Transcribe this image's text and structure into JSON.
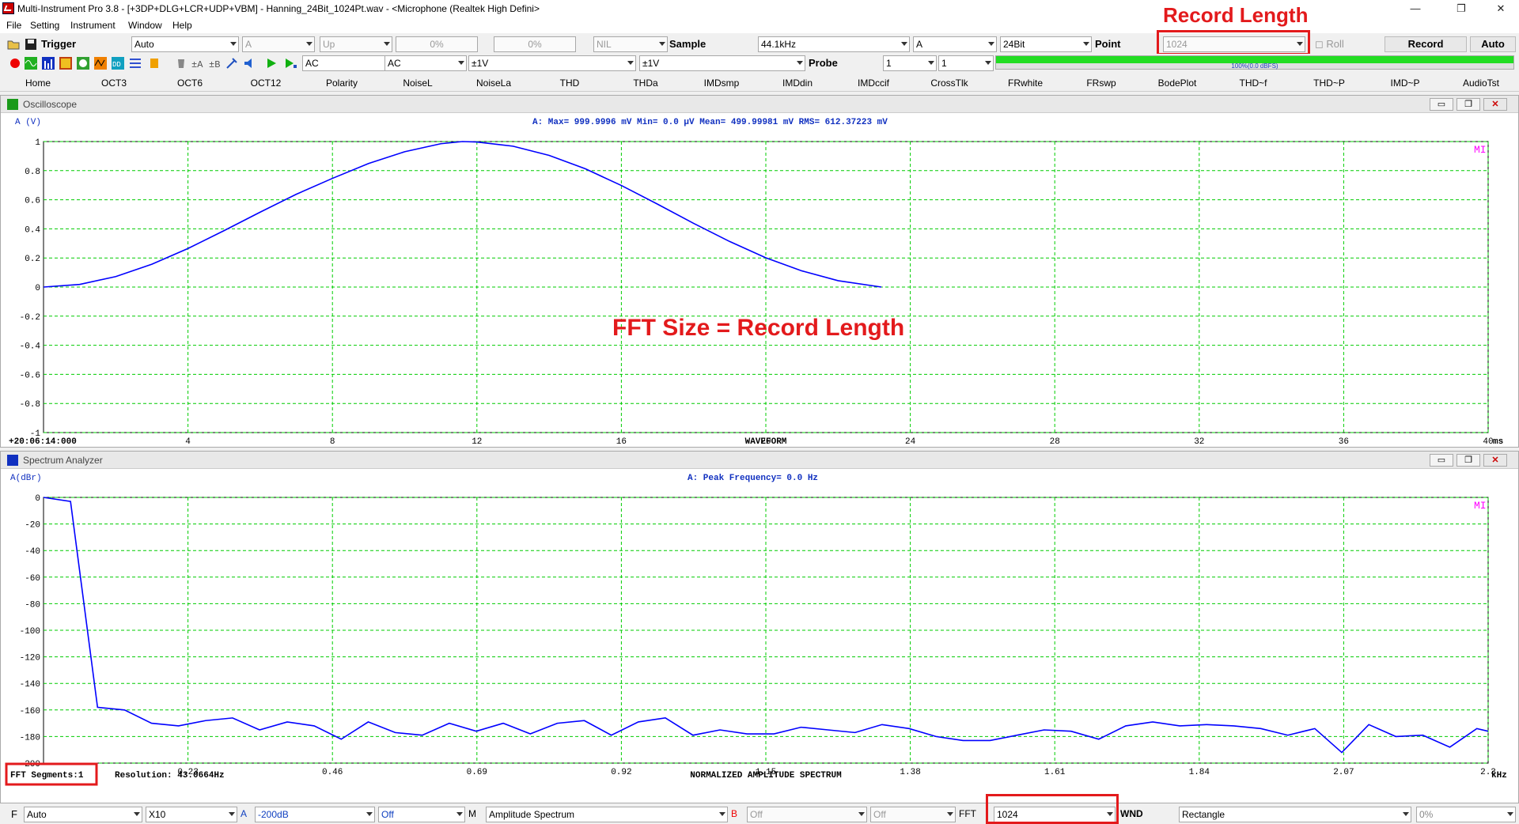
{
  "window": {
    "title": "Multi-Instrument Pro 3.8  -  [+3DP+DLG+LCR+UDP+VBM]  -  Hanning_24Bit_1024Pt.wav  -  <Microphone (Realtek High Defini>",
    "minimize": "—",
    "maximize": "❐",
    "close": "✕"
  },
  "menu": [
    "File",
    "Setting",
    "Instrument",
    "Window",
    "Help"
  ],
  "toolbar1": {
    "trigger_label": "Trigger",
    "trigger_mode": "Auto",
    "trigger_channel": "A",
    "trigger_edge": "Up",
    "trigger_level": "0%",
    "trigger_delay": "0%",
    "trigger_nil": "NIL",
    "sample_label": "Sample",
    "sample_rate": "44.1kHz",
    "sample_channel": "A",
    "bit_depth": "24Bit",
    "point_label": "Point",
    "record_length": "1024",
    "roll_label": "Roll",
    "record_button": "Record",
    "auto_button": "Auto"
  },
  "toolbar2": {
    "coupling_a": "AC",
    "coupling_b": "AC",
    "range_a": "±1V",
    "range_b": "±1V",
    "probe_label": "Probe",
    "probe_a": "1",
    "probe_b": "1",
    "progress_text": "100%(0.0 dBFS)",
    "progress_fraction": 1.0
  },
  "tabs": [
    "Home",
    "OCT3",
    "OCT6",
    "OCT12",
    "Polarity",
    "NoiseL",
    "NoiseLa",
    "THD",
    "THDa",
    "IMDsmp",
    "IMDdin",
    "IMDccif",
    "CrossTlk",
    "FRwhite",
    "FRswp",
    "BodePlot",
    "THD~f",
    "THD~P",
    "IMD~P",
    "AudioTst"
  ],
  "annotations": {
    "record_length": "Record Length",
    "fft_size": "FFT Size = Record Length"
  },
  "oscilloscope": {
    "title": "Oscilloscope",
    "unit_label": "A (V)",
    "stats": "A: Max=   999.9996 mV  Min=      0.0 µV  Mean=   499.99981 mV  RMS=   612.37223 mV",
    "timestamp": "+20:06:14:000",
    "xlabel": "WAVEFORM",
    "xunit": "ms",
    "mi_badge": "MI"
  },
  "spectrum": {
    "title": "Spectrum Analyzer",
    "unit_label": "A(dBr)",
    "peak": "A: Peak Frequency=    0.0  Hz",
    "xlabel": "NORMALIZED AMPLITUDE SPECTRUM",
    "xunit": "kHz",
    "segments": "FFT Segments:1",
    "resolution": "Resolution: 43.0664Hz",
    "mi_badge": "MI"
  },
  "bottombar": {
    "f_label": "F",
    "f_mode": "Auto",
    "zoom": "X10",
    "a_label": "A",
    "a_range": "-200dB",
    "a_off": "Off",
    "m_label": "M",
    "m_mode": "Amplitude Spectrum",
    "b_label": "B",
    "b_off1": "Off",
    "b_off2": "Off",
    "fft_label": "FFT",
    "fft_size": "1024",
    "wnd_label": "WND",
    "window_fn": "Rectangle",
    "overlap": "0%"
  },
  "colors": {
    "trace": "#0000ff",
    "grid": "#00cc00",
    "annotation": "#e31a1c",
    "mi_badge": "#ff00ff"
  },
  "chart_data": [
    {
      "type": "line",
      "name": "oscilloscope",
      "xlabel": "WAVEFORM",
      "xunit": "ms",
      "ylabel": "A (V)",
      "xlim": [
        0,
        40
      ],
      "ylim": [
        -1,
        1
      ],
      "xticks": [
        4,
        8,
        12,
        16,
        20,
        24,
        28,
        32,
        36,
        40
      ],
      "yticks": [
        1,
        0.8,
        0.6,
        0.4,
        0.2,
        0,
        -0.2,
        -0.4,
        -0.6,
        -0.8,
        -1
      ],
      "ytick_labels": [
        "1",
        "0.8",
        "0.6",
        "0.4",
        "0.2",
        "0",
        "-0.2",
        "-0.4",
        "-0.6",
        "-0.8",
        "-1"
      ],
      "grid": true,
      "series": [
        {
          "x": [
            0,
            1,
            2,
            3,
            4,
            5,
            6,
            7,
            8,
            9,
            10,
            11,
            11.6,
            12,
            13,
            14,
            15,
            16,
            17,
            18,
            19,
            20,
            21,
            22,
            23.2
          ],
          "y": [
            0,
            0.018,
            0.072,
            0.157,
            0.265,
            0.388,
            0.515,
            0.638,
            0.747,
            0.849,
            0.93,
            0.985,
            1.0,
            0.997,
            0.968,
            0.905,
            0.813,
            0.698,
            0.57,
            0.438,
            0.313,
            0.201,
            0.111,
            0.044,
            0
          ]
        }
      ]
    },
    {
      "type": "line",
      "name": "spectrum",
      "xlabel": "NORMALIZED AMPLITUDE SPECTRUM",
      "xunit": "kHz",
      "ylabel": "A(dBr)",
      "xlim": [
        0,
        2.3
      ],
      "ylim": [
        -200,
        0
      ],
      "xticks": [
        0.23,
        0.46,
        0.69,
        0.92,
        1.15,
        1.38,
        1.61,
        1.84,
        2.07,
        2.3
      ],
      "yticks": [
        0,
        -20,
        -40,
        -60,
        -80,
        -100,
        -120,
        -140,
        -160,
        -180,
        -200
      ],
      "grid": true,
      "series": [
        {
          "x": [
            0.0,
            0.043,
            0.086,
            0.129,
            0.172,
            0.215,
            0.258,
            0.301,
            0.344,
            0.388,
            0.431,
            0.474,
            0.517,
            0.56,
            0.603,
            0.646,
            0.689,
            0.732,
            0.775,
            0.818,
            0.861,
            0.904,
            0.947,
            0.99,
            1.034,
            1.077,
            1.12,
            1.163,
            1.206,
            1.249,
            1.292,
            1.335,
            1.378,
            1.421,
            1.464,
            1.507,
            1.55,
            1.593,
            1.636,
            1.68,
            1.723,
            1.766,
            1.809,
            1.852,
            1.895,
            1.938,
            1.981,
            2.024,
            2.067,
            2.11,
            2.153,
            2.196,
            2.239,
            2.282,
            2.3
          ],
          "y": [
            0,
            -3,
            -158,
            -160,
            -170,
            -172,
            -168,
            -166,
            -175,
            -169,
            -172,
            -182,
            -169,
            -177,
            -179,
            -170,
            -176,
            -170,
            -178,
            -170,
            -168,
            -179,
            -169,
            -166,
            -179,
            -175,
            -178,
            -178,
            -173,
            -175,
            -177,
            -171,
            -174,
            -180,
            -183,
            -183,
            -179,
            -175,
            -176,
            -182,
            -172,
            -169,
            -172,
            -171,
            -172,
            -174,
            -179,
            -174,
            -192,
            -171,
            -180,
            -179,
            -188,
            -174,
            -176
          ]
        }
      ]
    }
  ]
}
